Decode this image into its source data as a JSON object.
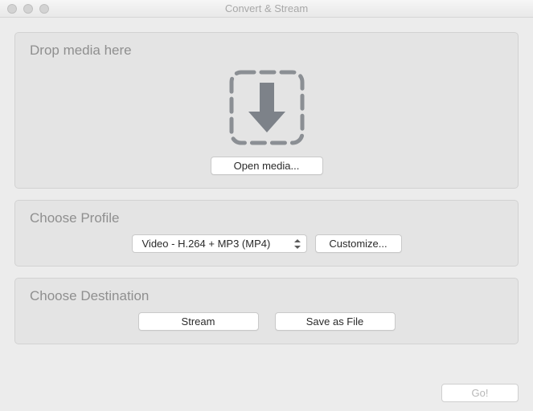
{
  "window": {
    "title": "Convert & Stream"
  },
  "dropzone": {
    "title": "Drop media here",
    "open_button": "Open media..."
  },
  "profile": {
    "title": "Choose Profile",
    "selected": "Video - H.264 + MP3 (MP4)",
    "customize_button": "Customize..."
  },
  "destination": {
    "title": "Choose Destination",
    "stream_button": "Stream",
    "save_button": "Save as File"
  },
  "footer": {
    "go_button": "Go!"
  }
}
